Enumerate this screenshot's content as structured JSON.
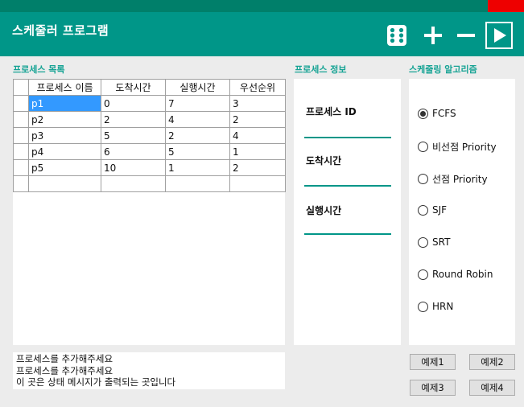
{
  "app": {
    "title": "스케줄러 프로그램"
  },
  "toolbar": {
    "icons": [
      "dice-icon",
      "plus-icon",
      "minus-icon",
      "play-icon"
    ],
    "accent": "#009688",
    "close_color": "#ee0000"
  },
  "sections": {
    "process_list": "프로세스 목록",
    "process_info": "프로세스 정보",
    "algorithm": "스케줄링 알고리즘"
  },
  "grid": {
    "columns": [
      "프로세스 이름",
      "도착시간",
      "실행시간",
      "우선순위"
    ],
    "rows": [
      [
        "p1",
        "0",
        "7",
        "3"
      ],
      [
        "p2",
        "2",
        "4",
        "2"
      ],
      [
        "p3",
        "5",
        "2",
        "4"
      ],
      [
        "p4",
        "6",
        "5",
        "1"
      ],
      [
        "p5",
        "10",
        "1",
        "2"
      ]
    ]
  },
  "info": {
    "id_label": "프로세스 ID",
    "arrival_label": "도착시간",
    "burst_label": "실행시간",
    "id_value": "",
    "arrival_value": "",
    "burst_value": ""
  },
  "algorithms": {
    "selected": "FCFS",
    "options": [
      "FCFS",
      "비선점 Priority",
      "선점 Priority",
      "SJF",
      "SRT",
      "Round Robin",
      "HRN"
    ]
  },
  "status": {
    "lines": [
      "프로세스를 추가해주세요",
      "프로세스를 추가해주세요",
      "이 곳은 상태 메시지가 출력되는 곳입니다"
    ]
  },
  "examples": {
    "ex1": "예제1",
    "ex2": "예제2",
    "ex3": "예제3",
    "ex4": "예제4"
  }
}
